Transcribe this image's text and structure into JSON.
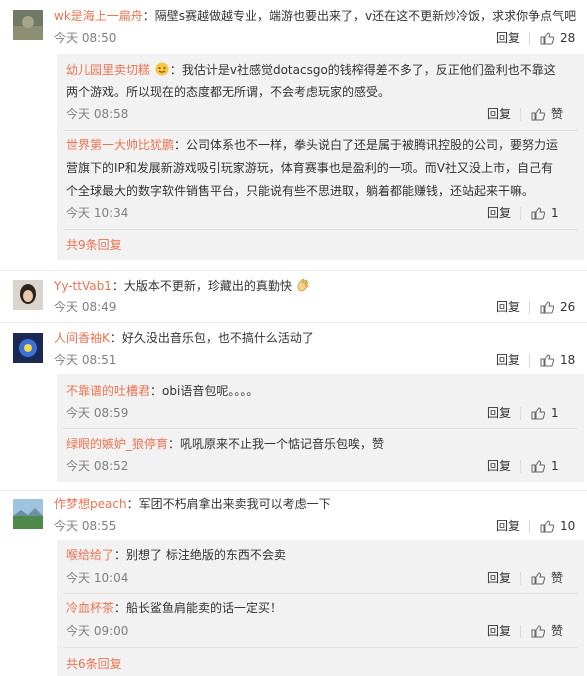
{
  "colors": {
    "username": "#eb7350",
    "text": "#333333",
    "meta": "#808080",
    "reply_bg": "#f2f2f2"
  },
  "labels": {
    "reply": "回复",
    "like": "赞",
    "colon": "："
  },
  "threads": [
    {
      "user": "wk是海上一扁舟",
      "text": "隔壁s赛越做越专业，端游也要出来了，v还在这不更新炒冷饭，求求你争点气吧",
      "time": "今天 08:50",
      "likes": "28",
      "replies": [
        {
          "user": "幼儿园里卖切糕",
          "text_lines": [
            "我估计是v社感觉dotacsgo的钱榨得差不多了，反正他们盈利也不靠这",
            "两个游戏。所以现在的态度都无所谓，不会考虑玩家的感受。"
          ],
          "time": "今天 08:58",
          "likes": "赞"
        },
        {
          "user": "世界第一大帅比犹鹏",
          "text_lines": [
            "公司体系也不一样，拳头说白了还是属于被腾讯控股的公司，要努力运",
            "营旗下的IP和发展新游戏吸引玩家游玩，体育赛事也是盈利的一项。而V社又没上市，自己有",
            "个全球最大的数字软件销售平台，只能说有些不思进取，躺着都能赚钱，还站起来干嘛。"
          ],
          "time": "今天 10:34",
          "likes": "1"
        }
      ],
      "more": "共9条回复"
    },
    {
      "user": "Yy-ttVab1",
      "text": "大版本不更新，珍藏出的真勤快",
      "time": "今天 08:49",
      "likes": "26",
      "replies": []
    },
    {
      "user": "人间香袖K",
      "text": "好久没出音乐包，也不搞什么活动了",
      "time": "今天 08:51",
      "likes": "18",
      "replies": [
        {
          "user": "不靠谱的吐槽君",
          "text_lines": [
            "obi语音包呢。。。。"
          ],
          "time": "今天 08:59",
          "likes": "1"
        },
        {
          "user": "绿眼的嫉妒_狼停育",
          "text_lines": [
            "吼吼原来不止我一个惦记音乐包唉，赞"
          ],
          "time": "今天 08:52",
          "likes": "1"
        }
      ]
    },
    {
      "user": "作梦想peach",
      "text": "军团不朽肩拿出来卖我可以考虑一下",
      "time": "今天 08:55",
      "likes": "10",
      "replies": [
        {
          "user": "喉给给了",
          "text_lines": [
            "别想了 标注绝版的东西不会卖"
          ],
          "time": "今天 10:04",
          "likes": "赞"
        },
        {
          "user": "冷血杯茶",
          "text_lines": [
            "船长鲨鱼肩能卖的话一定买！"
          ],
          "time": "今天 09:00",
          "likes": "赞"
        }
      ],
      "more": "共6条回复"
    }
  ]
}
